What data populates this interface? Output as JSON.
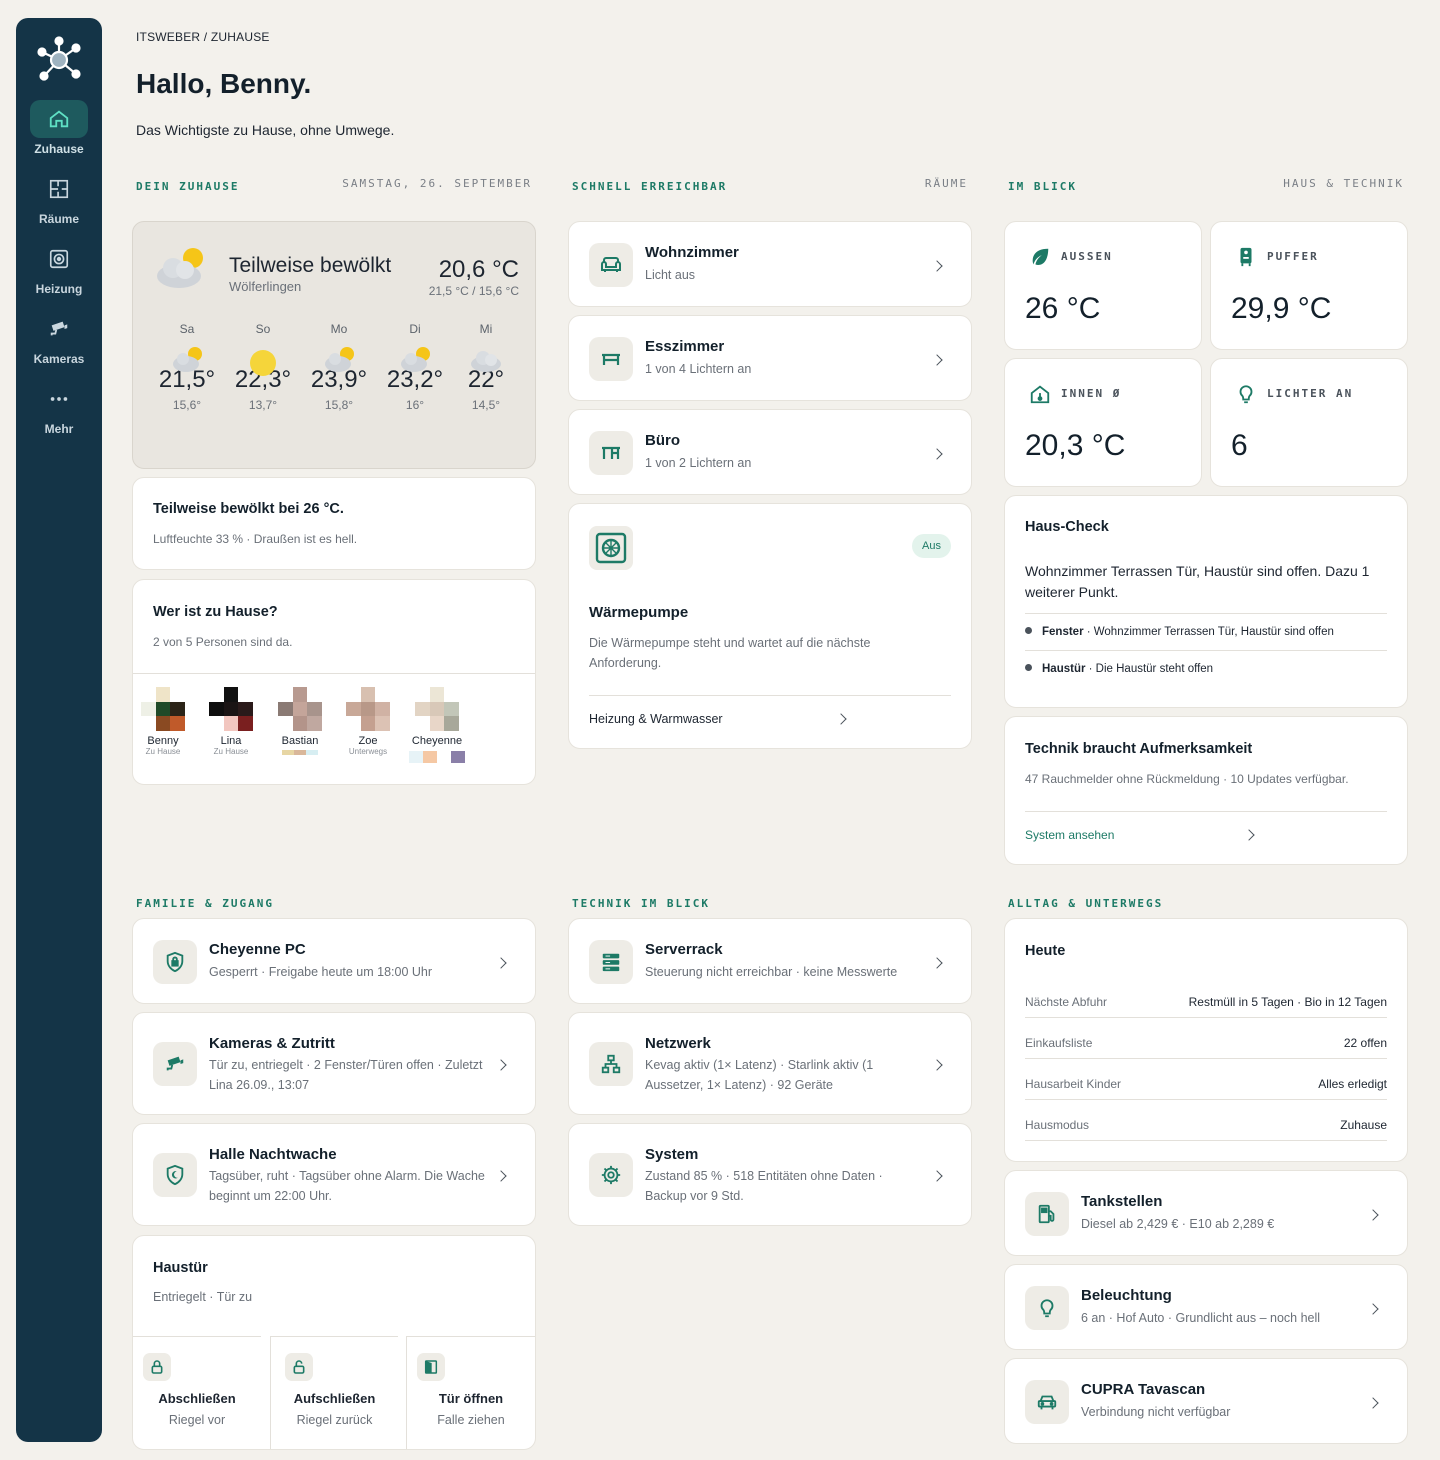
{
  "sidebar": {
    "items": [
      {
        "label": "Zuhause",
        "icon": "home-icon"
      },
      {
        "label": "Räume",
        "icon": "floorplan-icon"
      },
      {
        "label": "Heizung",
        "icon": "heating-icon"
      },
      {
        "label": "Kameras",
        "icon": "camera-icon"
      },
      {
        "label": "Mehr",
        "icon": "more-icon"
      }
    ]
  },
  "header": {
    "breadcrumb": "ITSWEBER / ZUHAUSE",
    "greeting": "Hallo, Benny.",
    "subtitle": "Das Wichtigste zu Hause, ohne Umwege."
  },
  "sections": {
    "home": {
      "title": "DEIN ZUHAUSE",
      "right": "SAMSTAG, 26. SEPTEMBER"
    },
    "quick": {
      "title": "SCHNELL ERREICHBAR",
      "right": "RÄUME"
    },
    "glance": {
      "title": "IM BLICK",
      "right": "HAUS & TECHNIK"
    },
    "family": {
      "title": "FAMILIE & ZUGANG"
    },
    "tech": {
      "title": "TECHNIK IM BLICK"
    },
    "daily": {
      "title": "ALLTAG & UNTERWEGS"
    }
  },
  "weather": {
    "condition": "Teilweise bewölkt",
    "location": "Wölferlingen",
    "temp": "20,6 °C",
    "range": "21,5 °C / 15,6 °C",
    "forecast": [
      {
        "day": "Sa",
        "hi": "21,5°",
        "lo": "15,6°",
        "icon": "partly-cloudy-icon"
      },
      {
        "day": "So",
        "hi": "22,3°",
        "lo": "13,7°",
        "icon": "sunny-icon"
      },
      {
        "day": "Mo",
        "hi": "23,9°",
        "lo": "15,8°",
        "icon": "partly-cloudy-icon"
      },
      {
        "day": "Di",
        "hi": "23,2°",
        "lo": "16°",
        "icon": "partly-cloudy-icon"
      },
      {
        "day": "Mi",
        "hi": "22°",
        "lo": "14,5°",
        "icon": "cloudy-icon"
      }
    ]
  },
  "summary": {
    "title": "Teilweise bewölkt bei 26 °C.",
    "detail": "Luftfeuchte 33 % · Draußen ist es hell."
  },
  "presence": {
    "title": "Wer ist zu Hause?",
    "detail": "2 von 5 Personen sind da.",
    "people": [
      {
        "name": "Benny",
        "status": "Zu Hause"
      },
      {
        "name": "Lina",
        "status": "Zu Hause"
      },
      {
        "name": "Bastian",
        "status": ""
      },
      {
        "name": "Zoe",
        "status": "Unterwegs"
      },
      {
        "name": "Cheyenne",
        "status": ""
      }
    ]
  },
  "rooms": [
    {
      "name": "Wohnzimmer",
      "detail": "Licht aus",
      "icon": "sofa-icon"
    },
    {
      "name": "Esszimmer",
      "detail": "1 von 4 Lichtern an",
      "icon": "table-icon"
    },
    {
      "name": "Büro",
      "detail": "1 von 2 Lichtern an",
      "icon": "desk-icon"
    }
  ],
  "heatpump": {
    "title": "Wärmepumpe",
    "badge": "Aus",
    "detail": "Die Wärmepumpe steht und wartet auf die nächste Anforderung.",
    "link": "Heizung & Warmwasser"
  },
  "stats": [
    {
      "label": "AUSSEN",
      "value": "26 °C",
      "icon": "leaf-icon"
    },
    {
      "label": "PUFFER",
      "value": "29,9 °C",
      "icon": "boiler-icon"
    },
    {
      "label": "INNEN Ø",
      "value": "20,3 °C",
      "icon": "house-temp-icon"
    },
    {
      "label": "LICHTER AN",
      "value": "6",
      "icon": "bulb-icon"
    }
  ],
  "houseCheck": {
    "title": "Haus-Check",
    "summary": "Wohnzimmer Terrassen Tür, Haustür sind offen. Dazu 1 weiterer Punkt.",
    "items": [
      {
        "label": "Fenster",
        "text": " · Wohnzimmer Terrassen Tür, Haustür sind offen"
      },
      {
        "label": "Haustür",
        "text": " · Die Haustür steht offen"
      }
    ]
  },
  "techAttention": {
    "title": "Technik braucht Aufmerksamkeit",
    "detail": "47 Rauchmelder ohne Rückmeldung · 10 Updates verfügbar.",
    "link": "System ansehen"
  },
  "family": [
    {
      "name": "Cheyenne PC",
      "detail": "Gesperrt · Freigabe heute um 18:00 Uhr",
      "icon": "shield-lock-icon"
    },
    {
      "name": "Kameras & Zutritt",
      "detail": "Tür zu, entriegelt · 2 Fenster/Türen offen · Zuletzt Lina 26.09., 13:07",
      "icon": "camera-icon"
    },
    {
      "name": "Halle Nachtwache",
      "detail": "Tagsüber, ruht · Tagsüber ohne Alarm. Die Wache beginnt um 22:00 Uhr.",
      "icon": "shield-moon-icon"
    }
  ],
  "door": {
    "title": "Haustür",
    "detail": "Entriegelt · Tür zu",
    "actions": [
      {
        "label": "Abschließen",
        "sub": "Riegel vor",
        "icon": "lock-icon"
      },
      {
        "label": "Aufschließen",
        "sub": "Riegel zurück",
        "icon": "unlock-icon"
      },
      {
        "label": "Tür öffnen",
        "sub": "Falle ziehen",
        "icon": "door-open-icon"
      }
    ]
  },
  "tech": [
    {
      "name": "Serverrack",
      "detail": "Steuerung nicht erreichbar · keine Messwerte",
      "icon": "server-icon"
    },
    {
      "name": "Netzwerk",
      "detail": "Kevag aktiv (1× Latenz) · Starlink aktiv (1 Aussetzer, 1× Latenz) · 92 Geräte",
      "icon": "network-icon"
    },
    {
      "name": "System",
      "detail": "Zustand 85 % · 518 Entitäten ohne Daten · Backup vor 9 Std.",
      "icon": "gear-icon"
    }
  ],
  "today": {
    "title": "Heute",
    "rows": [
      {
        "k": "Nächste Abfuhr",
        "v": "Restmüll in 5 Tagen · Bio in 12 Tagen"
      },
      {
        "k": "Einkaufsliste",
        "v": "22 offen"
      },
      {
        "k": "Hausarbeit Kinder",
        "v": "Alles erledigt"
      },
      {
        "k": "Hausmodus",
        "v": "Zuhause"
      }
    ]
  },
  "daily": [
    {
      "name": "Tankstellen",
      "detail": "Diesel ab 2,429 € · E10 ab 2,289 €",
      "icon": "fuel-icon"
    },
    {
      "name": "Beleuchtung",
      "detail": "6 an · Hof Auto · Grundlicht aus – noch hell",
      "icon": "bulb-icon"
    },
    {
      "name": "CUPRA Tavascan",
      "detail": "Verbindung nicht verfügbar",
      "icon": "car-icon"
    }
  ],
  "colors": {
    "sidebar": "#143447",
    "accent": "#1d7a66",
    "background": "#f3f1ec"
  }
}
